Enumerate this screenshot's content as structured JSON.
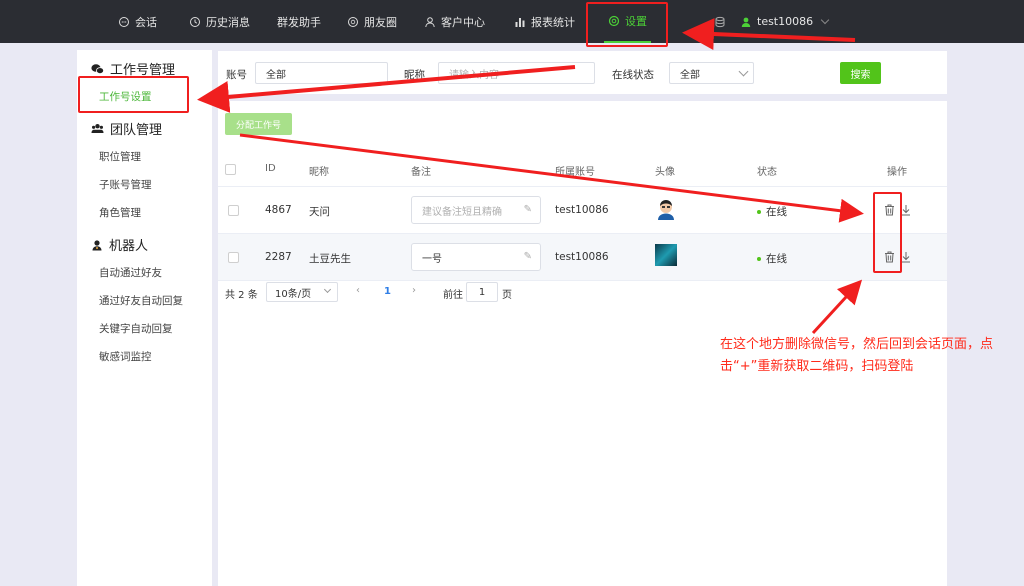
{
  "nav": {
    "items": [
      "会话",
      "历史消息",
      "群发助手",
      "朋友圈",
      "客户中心",
      "报表统计",
      "设置"
    ],
    "active": "设置",
    "user": "test10086"
  },
  "sidebar": {
    "groups": [
      {
        "title": "工作号管理",
        "items": [
          "工作号设置"
        ]
      },
      {
        "title": "团队管理",
        "items": [
          "职位管理",
          "子账号管理",
          "角色管理"
        ]
      },
      {
        "title": "机器人",
        "items": [
          "自动通过好友",
          "通过好友自动回复",
          "关键字自动回复",
          "敏感词监控"
        ]
      }
    ],
    "active_item": "工作号设置"
  },
  "filters": {
    "account_label": "账号",
    "account_value": "全部",
    "nickname_label": "昵称",
    "nickname_placeholder": "请输入内容",
    "status_label": "在线状态",
    "status_value": "全部",
    "search_button": "搜索"
  },
  "assign_button": "分配工作号",
  "table": {
    "columns": [
      "ID",
      "昵称",
      "备注",
      "所属账号",
      "头像",
      "状态",
      "操作"
    ],
    "rows": [
      {
        "id": "4867",
        "nickname": "天问",
        "note_placeholder": "建议备注短且精确",
        "note_value": "",
        "account": "test10086",
        "status": "在线"
      },
      {
        "id": "2287",
        "nickname": "土豆先生",
        "note_placeholder": "",
        "note_value": "一号",
        "account": "test10086",
        "status": "在线"
      }
    ]
  },
  "pagination": {
    "total": "共 2 条",
    "page_size": "10条/页",
    "current_page": "1",
    "goto_label": "前往",
    "goto_value": "1",
    "page_suffix": "页"
  },
  "annotation": {
    "text": "在这个地方删除微信号，然后回到会话页面，点击“+”重新获取二维码，扫码登陆",
    "color": "#ff2a1a"
  },
  "colors": {
    "accent": "#52c41a",
    "nav_bg": "#2b2d33",
    "highlight": "#f01f1f"
  }
}
